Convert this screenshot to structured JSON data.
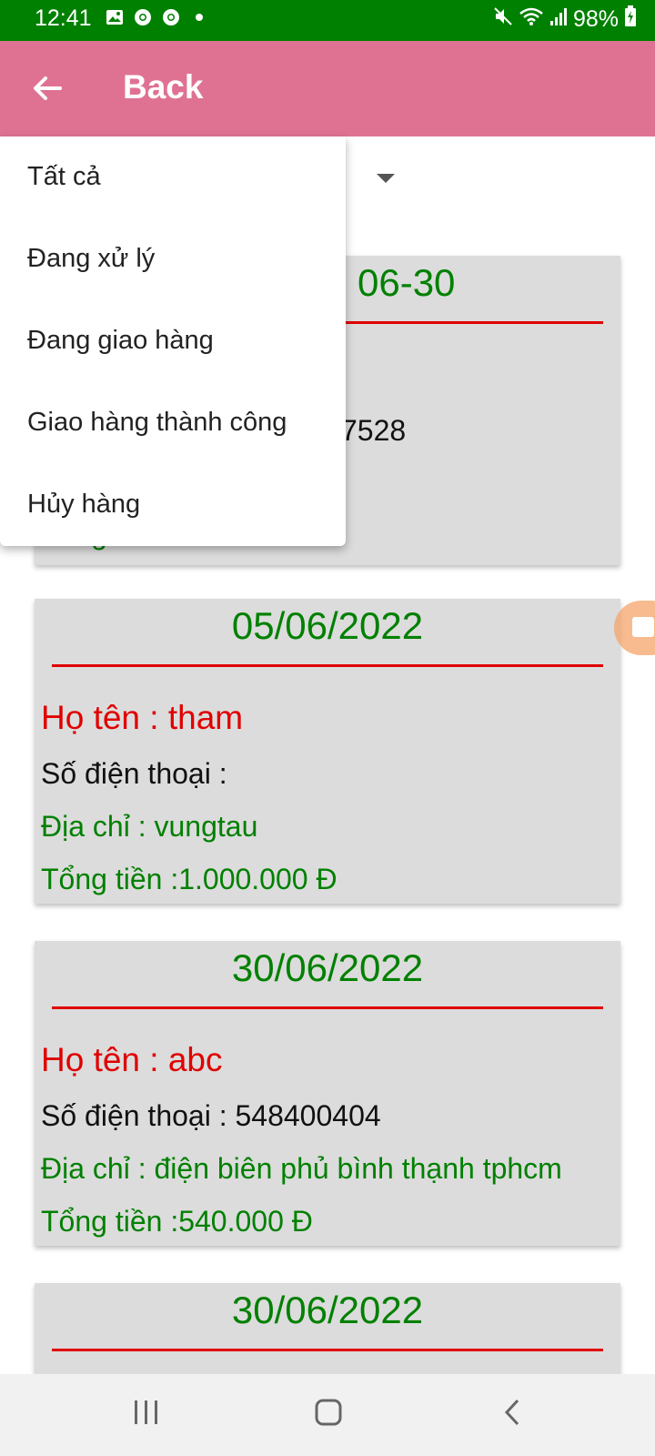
{
  "status_bar": {
    "time": "12:41",
    "battery": "98%",
    "left_icons": [
      "image-icon",
      "chrome-icon",
      "chrome-icon",
      "dot-icon"
    ],
    "right_icons": [
      "mute-icon",
      "wifi-icon",
      "signal-icon",
      "battery-charging-icon"
    ]
  },
  "app_bar": {
    "title": "Back",
    "icon": "back-arrow-icon"
  },
  "filter_menu": {
    "items": [
      "Tất cả",
      "Đang xử lý",
      "Đang giao hàng",
      "Giao hàng thành công",
      "Hủy hàng"
    ]
  },
  "orders": [
    {
      "date_visible": "06-30",
      "phone_visible": "7528",
      "total_visible": "Tổng tiền :400.000 Đ"
    },
    {
      "date": "05/06/2022",
      "name": "Họ tên : tham",
      "phone": "Số điện thoại :",
      "address": "Địa chỉ : vungtau",
      "total": "Tổng tiền :1.000.000 Đ"
    },
    {
      "date": "30/06/2022",
      "name": "Họ tên : abc",
      "phone": "Số điện thoại : 548400404",
      "address": "Địa chỉ : điện biên phủ bình thạnh tphcm",
      "total": "Tổng tiền :540.000 Đ"
    },
    {
      "date": "30/06/2022"
    }
  ],
  "nav_bar": {
    "icons": [
      "recent-apps-icon",
      "home-icon",
      "back-icon"
    ]
  },
  "colors": {
    "status_bar": "#008000",
    "app_bar": "#df7293",
    "accent_green": "#008000",
    "accent_red": "#e00000",
    "card_bg": "#dcdcdc"
  }
}
